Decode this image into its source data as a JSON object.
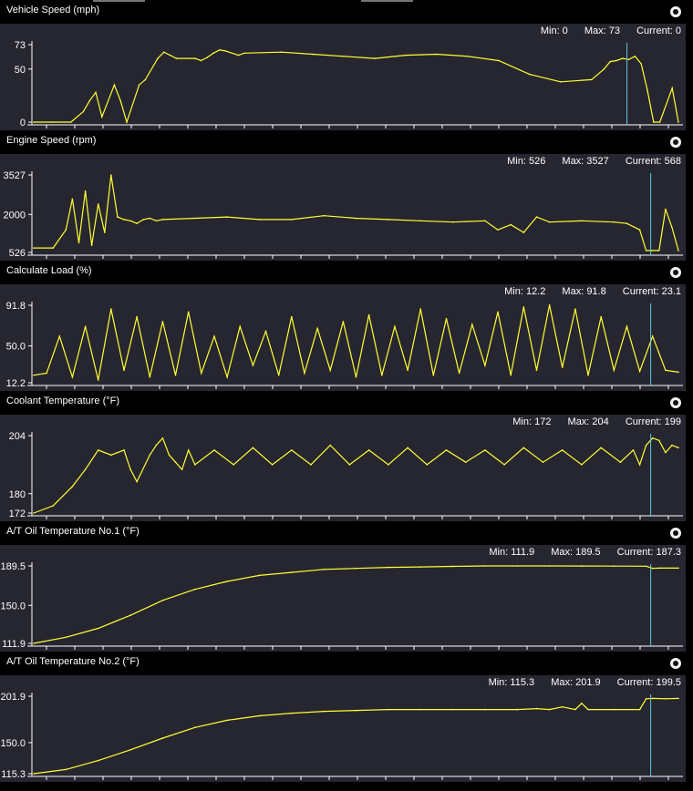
{
  "panels": [
    {
      "title": "Vehicle Speed (mph)",
      "stats": {
        "min": "Min: 0",
        "max": "Max: 73",
        "current": "Current: 0"
      },
      "y_ticks": [
        "73",
        "50",
        "0"
      ],
      "chart_data": {
        "type": "line",
        "title": "Vehicle Speed (mph)",
        "ylim": [
          0,
          73
        ],
        "x": [
          0,
          3,
          6,
          8,
          9,
          10,
          11,
          13,
          14,
          15,
          17,
          18,
          20,
          21,
          22,
          23,
          26,
          27,
          28,
          29,
          30,
          31,
          33,
          34,
          40,
          45,
          50,
          55,
          60,
          65,
          70,
          75,
          80,
          85,
          90,
          92,
          93,
          94,
          95,
          96,
          97,
          98,
          99,
          100,
          101,
          103,
          104
        ],
        "values": [
          0,
          0,
          0,
          10,
          20,
          28,
          5,
          35,
          20,
          0,
          35,
          40,
          60,
          66,
          63,
          60,
          60,
          58,
          61,
          65,
          68,
          67,
          63,
          65,
          66,
          64,
          62,
          60,
          63,
          64,
          62,
          58,
          45,
          38,
          40,
          50,
          57,
          58,
          60,
          59,
          62,
          55,
          30,
          0,
          0,
          32,
          0
        ],
        "cursor_x": 95.7,
        "color": "#ffff33"
      }
    },
    {
      "title": "Engine Speed (rpm)",
      "stats": {
        "min": "Min: 526",
        "max": "Max: 3527",
        "current": "Current: 568"
      },
      "y_ticks": [
        "3527",
        "2000",
        "526"
      ],
      "chart_data": {
        "type": "line",
        "title": "Engine Speed (rpm)",
        "ylim": [
          526,
          3527
        ],
        "x": [
          0,
          3,
          5,
          6,
          7,
          8,
          9,
          10,
          11,
          12,
          13,
          14,
          15,
          16,
          17,
          18,
          19,
          20,
          25,
          30,
          35,
          40,
          45,
          50,
          55,
          60,
          65,
          70,
          72,
          74,
          76,
          78,
          80,
          85,
          90,
          92,
          94,
          95,
          96,
          97,
          98,
          99,
          100
        ],
        "values": [
          700,
          700,
          1400,
          2600,
          900,
          2900,
          800,
          2400,
          1300,
          3527,
          1900,
          1800,
          1750,
          1650,
          1800,
          1850,
          1750,
          1800,
          1850,
          1900,
          1800,
          1800,
          1950,
          1850,
          1800,
          1750,
          1700,
          1750,
          1400,
          1600,
          1300,
          1900,
          1700,
          1750,
          1700,
          1650,
          1400,
          600,
          600,
          600,
          2200,
          1500,
          600
        ],
        "cursor_x": 95.7,
        "color": "#ffff33"
      }
    },
    {
      "title": "Calculate Load (%)",
      "stats": {
        "min": "Min: 12.2",
        "max": "Max: 91.8",
        "current": "Current: 23.1"
      },
      "y_ticks": [
        "91.8",
        "50.0",
        "12.2"
      ],
      "chart_data": {
        "type": "line",
        "title": "Calculate Load (%)",
        "ylim": [
          12.2,
          91.8
        ],
        "x": [
          0,
          2,
          4,
          6,
          8,
          10,
          12,
          14,
          16,
          18,
          20,
          22,
          24,
          26,
          28,
          30,
          32,
          34,
          36,
          38,
          40,
          42,
          44,
          46,
          48,
          50,
          52,
          54,
          56,
          58,
          60,
          62,
          64,
          66,
          68,
          70,
          72,
          74,
          76,
          78,
          80,
          82,
          84,
          86,
          88,
          90,
          92,
          94,
          96,
          98,
          100
        ],
        "values": [
          20,
          22,
          60,
          18,
          70,
          15,
          88,
          25,
          80,
          18,
          75,
          20,
          85,
          22,
          60,
          18,
          70,
          30,
          65,
          20,
          80,
          22,
          68,
          25,
          75,
          18,
          82,
          20,
          70,
          25,
          88,
          20,
          78,
          22,
          72,
          30,
          85,
          20,
          90,
          25,
          92,
          28,
          88,
          20,
          80,
          25,
          70,
          24,
          60,
          25,
          23.1
        ],
        "cursor_x": 95.7,
        "color": "#ffff33"
      }
    },
    {
      "title": "Coolant Temperature (°F)",
      "stats": {
        "min": "Min: 172",
        "max": "Max: 204",
        "current": "Current: 199"
      },
      "y_ticks": [
        "204",
        "180",
        "172"
      ],
      "chart_data": {
        "type": "line",
        "title": "Coolant Temperature (°F)",
        "ylim": [
          172,
          204
        ],
        "x": [
          0,
          3,
          6,
          8,
          10,
          12,
          14,
          15,
          16,
          18,
          19,
          20,
          21,
          22,
          23,
          24,
          25,
          28,
          31,
          34,
          37,
          40,
          43,
          46,
          49,
          52,
          55,
          58,
          61,
          64,
          67,
          70,
          73,
          76,
          79,
          82,
          85,
          88,
          91,
          93,
          94,
          95,
          96,
          97,
          98,
          99,
          100
        ],
        "values": [
          172,
          175,
          183,
          190,
          198,
          196,
          198,
          190,
          185,
          196,
          200,
          203,
          196,
          193,
          190,
          198,
          192,
          198,
          192,
          199,
          192,
          198,
          192,
          200,
          192,
          198,
          192,
          199,
          192,
          198,
          193,
          198,
          192,
          199,
          193,
          198,
          192,
          199,
          193,
          198,
          192,
          200,
          203,
          202,
          197,
          200,
          199
        ],
        "cursor_x": 95.7,
        "color": "#ffff33"
      }
    },
    {
      "title": "A/T Oil Temperature No.1 (°F)",
      "stats": {
        "min": "Min: 111.9",
        "max": "Max: 189.5",
        "current": "Current: 187.3"
      },
      "y_ticks": [
        "189.5",
        "150.0",
        "111.9"
      ],
      "chart_data": {
        "type": "line",
        "title": "A/T Oil Temperature No.1 (°F)",
        "ylim": [
          111.9,
          189.5
        ],
        "x": [
          0,
          5,
          10,
          15,
          20,
          25,
          30,
          35,
          40,
          45,
          50,
          55,
          60,
          65,
          70,
          75,
          80,
          85,
          90,
          95,
          96,
          97,
          100
        ],
        "values": [
          111.9,
          118,
          127,
          140,
          155,
          166,
          174,
          180,
          183,
          186,
          187,
          188,
          188.5,
          189,
          189.5,
          189.5,
          189.5,
          189.4,
          189.3,
          189.2,
          187,
          187.3,
          187.3
        ],
        "cursor_x": 95.7,
        "color": "#ffff33"
      }
    },
    {
      "title": "A/T Oil Temperature No.2 (°F)",
      "stats": {
        "min": "Min: 115.3",
        "max": "Max: 201.9",
        "current": "Current: 199.5"
      },
      "y_ticks": [
        "201.9",
        "150.0",
        "115.3"
      ],
      "chart_data": {
        "type": "line",
        "title": "A/T Oil Temperature No.2 (°F)",
        "ylim": [
          115.3,
          201.9
        ],
        "x": [
          0,
          5,
          10,
          15,
          20,
          25,
          30,
          35,
          40,
          45,
          50,
          55,
          60,
          65,
          70,
          75,
          78,
          80,
          82,
          84,
          85,
          86,
          90,
          94,
          95,
          96,
          98,
          100
        ],
        "values": [
          115.3,
          120,
          130,
          142,
          155,
          167,
          175,
          180,
          183,
          185,
          186,
          187,
          187,
          187,
          187,
          187,
          188,
          187,
          190,
          187,
          194,
          187,
          187,
          187,
          199,
          199.5,
          199,
          199.5
        ],
        "cursor_x": 95.7,
        "color": "#ffff33"
      }
    }
  ]
}
